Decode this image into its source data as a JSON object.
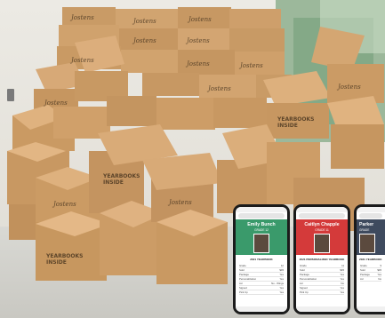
{
  "photo": {
    "box_brand": "Jostens",
    "box_side_text": "YEARBOOKS INSIDE"
  },
  "phones": [
    {
      "name": "Emily Bunch",
      "grade": "GRADE 12",
      "banner": "2021 YEARBOOK",
      "header_color": "#3a9a6b",
      "rows": [
        [
          "Grade",
          "12"
        ],
        [
          "Sold",
          "$45"
        ],
        [
          "Package",
          "Yes"
        ],
        [
          "Personalization",
          "Yes"
        ],
        [
          "Ad",
          "No - Wings"
        ],
        [
          "Signed",
          "Yes"
        ],
        [
          "Pick Up",
          "Yes"
        ]
      ]
    },
    {
      "name": "Caitlyn Chapple",
      "grade": "GRADE 11",
      "banner": "2021 PERSONALIZED YEARBOOK",
      "header_color": "#d43a3a",
      "rows": [
        [
          "Grade",
          "11"
        ],
        [
          "Sold",
          "$45"
        ],
        [
          "Package",
          "Yes"
        ],
        [
          "Personalization",
          "Yes"
        ],
        [
          "Ad",
          "No"
        ],
        [
          "Signed",
          "Yes"
        ],
        [
          "Pick Up",
          "Yes"
        ]
      ]
    },
    {
      "name": "Parker",
      "grade": "GRADE",
      "banner": "2021 YEARBOOK",
      "header_color": "#3e4a5e",
      "rows": [
        [
          "Grade",
          "9"
        ],
        [
          "Sold",
          "$45"
        ],
        [
          "Package",
          "Yes"
        ],
        [
          "Ad",
          "No"
        ]
      ]
    }
  ]
}
